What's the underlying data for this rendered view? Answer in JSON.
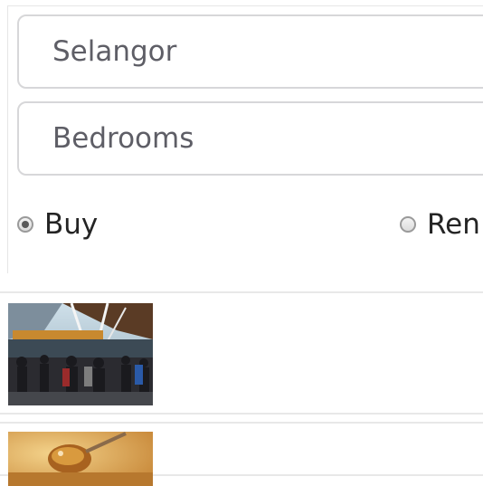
{
  "search": {
    "state_value": "Selangor",
    "bedrooms_placeholder": "Bedrooms"
  },
  "listing_type": {
    "buy_label": "Buy",
    "rent_label": "Ren",
    "selected": "buy"
  },
  "listings": [
    {
      "image": "airport-terminal-crowd-photo"
    },
    {
      "image": "soup-spoon-food-photo"
    }
  ]
}
